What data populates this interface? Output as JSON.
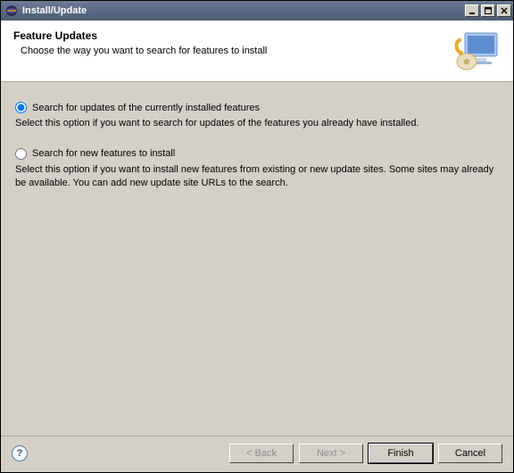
{
  "window": {
    "title": "Install/Update"
  },
  "header": {
    "heading": "Feature Updates",
    "subtitle": "Choose the way you want to search for features to install"
  },
  "options": {
    "updates": {
      "label": "Search for updates of the currently installed features",
      "description": "Select this option if you want to search for updates of the features you already have installed.",
      "selected": true
    },
    "newFeatures": {
      "label": "Search for new features to install",
      "description": "Select this option if you want to install new features from existing or new update sites. Some sites may already be available. You can add new update site URLs to the search.",
      "selected": false
    }
  },
  "buttons": {
    "back": "< Back",
    "next": "Next >",
    "finish": "Finish",
    "cancel": "Cancel"
  },
  "icons": {
    "app": "eclipse-icon",
    "header": "update-monitor-icon",
    "help": "?"
  },
  "colors": {
    "titlebar_start": "#6b7c94",
    "titlebar_end": "#4a5b73",
    "dialog_bg": "#d4d0c8",
    "header_bg": "#ffffff"
  }
}
